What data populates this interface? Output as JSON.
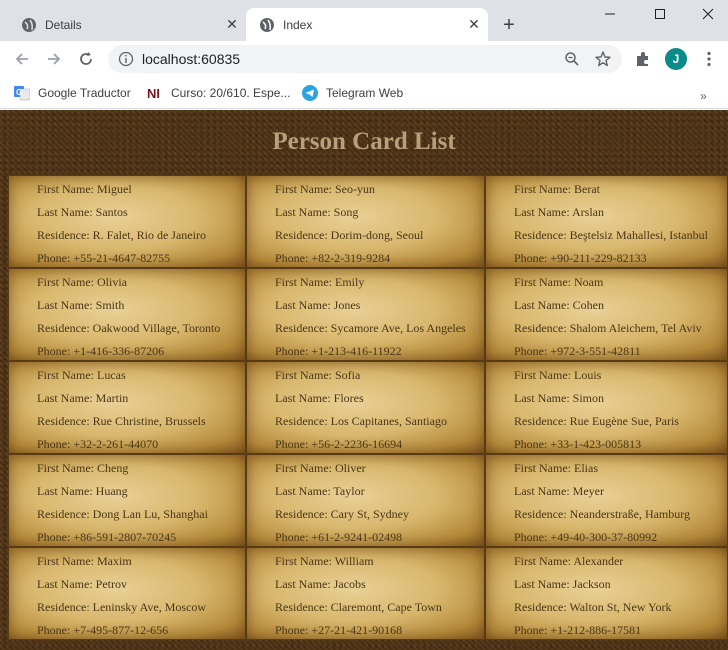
{
  "browser": {
    "tabs": [
      {
        "title": "Details",
        "active": false
      },
      {
        "title": "Index",
        "active": true
      }
    ],
    "url": "localhost:60835",
    "profile_initial": "J",
    "bookmarks": [
      {
        "label": "Google Traductor"
      },
      {
        "label": "Curso: 20/610. Espe..."
      },
      {
        "label": "Telegram Web"
      }
    ],
    "more_chevron": "»"
  },
  "page": {
    "title": "Person Card List",
    "labels": {
      "first": "First Name: ",
      "last": "Last Name: ",
      "residence": "Residence: ",
      "phone": "Phone: "
    },
    "persons": [
      {
        "first": "Miguel",
        "last": "Santos",
        "residence": "R. Falet, Rio de Janeiro",
        "phone": "+55-21-4647-82755"
      },
      {
        "first": "Seo-yun",
        "last": "Song",
        "residence": "Dorim-dong, Seoul",
        "phone": "+82-2-319-9284"
      },
      {
        "first": "Berat",
        "last": "Arslan",
        "residence": "Beştelsiz Mahallesi, Istanbul",
        "phone": "+90-211-229-82133"
      },
      {
        "first": "Olivia",
        "last": "Smith",
        "residence": "Oakwood Village, Toronto",
        "phone": "+1-416-336-87206"
      },
      {
        "first": "Emily",
        "last": "Jones",
        "residence": "Sycamore Ave, Los Angeles",
        "phone": "+1-213-416-11922"
      },
      {
        "first": "Noam",
        "last": "Cohen",
        "residence": "Shalom Aleichem, Tel Aviv",
        "phone": "+972-3-551-42811"
      },
      {
        "first": "Lucas",
        "last": "Martin",
        "residence": "Rue Christine, Brussels",
        "phone": "+32-2-261-44070"
      },
      {
        "first": "Sofia",
        "last": "Flores",
        "residence": "Los Capitanes, Santiago",
        "phone": "+56-2-2236-16694"
      },
      {
        "first": "Louis",
        "last": "Simon",
        "residence": "Rue Eugène Sue, Paris",
        "phone": "+33-1-423-005813"
      },
      {
        "first": "Cheng",
        "last": "Huang",
        "residence": "Dong Lan Lu, Shanghai",
        "phone": "+86-591-2807-70245"
      },
      {
        "first": "Oliver",
        "last": "Taylor",
        "residence": "Cary St, Sydney",
        "phone": "+61-2-9241-02498"
      },
      {
        "first": "Elias",
        "last": "Meyer",
        "residence": "Neanderstraße, Hamburg",
        "phone": "+49-40-300-37-80992"
      },
      {
        "first": "Maxim",
        "last": "Petrov",
        "residence": "Leninsky Ave, Moscow",
        "phone": "+7-495-877-12-656"
      },
      {
        "first": "William",
        "last": "Jacobs",
        "residence": "Claremont, Cape Town",
        "phone": "+27-21-421-90168"
      },
      {
        "first": "Alexander",
        "last": "Jackson",
        "residence": "Walton St, New York",
        "phone": "+1-212-886-17581"
      }
    ]
  }
}
